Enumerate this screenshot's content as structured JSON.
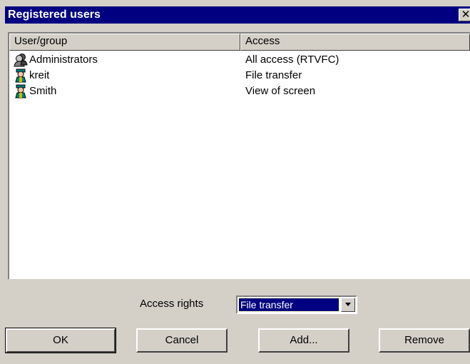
{
  "window": {
    "title": "Registered users",
    "close_glyph": "✕"
  },
  "list": {
    "columns": {
      "user": "User/group",
      "access": "Access"
    },
    "rows": [
      {
        "name": "Administrators",
        "access": "All access (RTVFC)",
        "icon": "group-icon"
      },
      {
        "name": "kreit",
        "access": "File transfer",
        "icon": "user-icon"
      },
      {
        "name": "Smith",
        "access": "View of screen",
        "icon": "user-icon"
      }
    ]
  },
  "access_rights": {
    "label": "Access rights",
    "selected": "File transfer"
  },
  "buttons": {
    "ok": "OK",
    "cancel": "Cancel",
    "add": "Add...",
    "remove": "Remove"
  },
  "colors": {
    "titlebar": "#000080",
    "face": "#d4d0c8",
    "selection": "#000080"
  }
}
